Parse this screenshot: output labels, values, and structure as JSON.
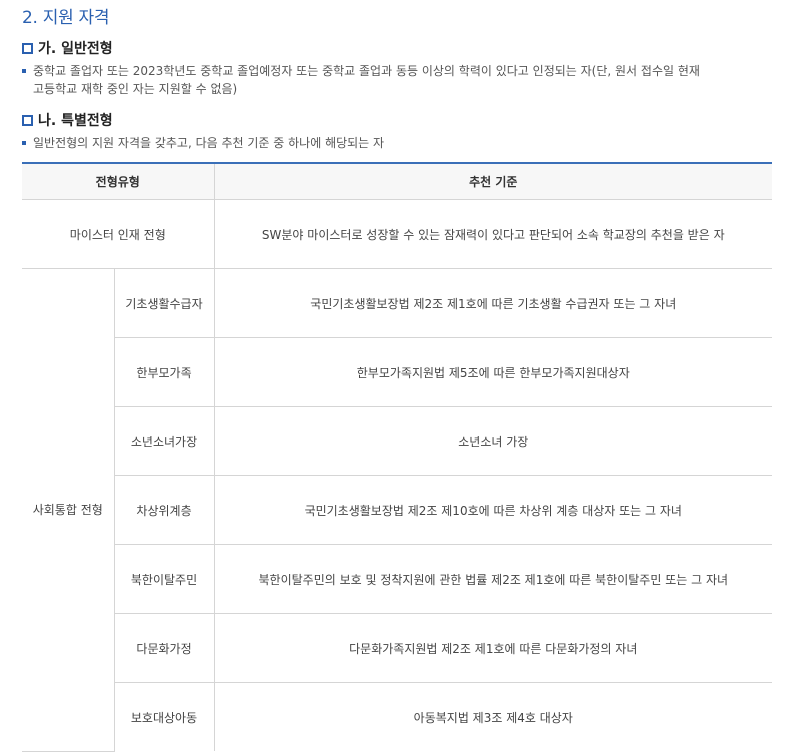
{
  "section": {
    "title": "2. 지원 자격"
  },
  "general": {
    "heading": "가. 일반전형",
    "line1": "중학교 졸업자 또는 2023학년도 중학교 졸업예정자 또는 중학교 졸업과 동등 이상의 학력이 있다고 인정되는 자(단, 원서 접수일 현재",
    "line2": "고등학교 재학 중인 자는 지원할 수 없음)"
  },
  "special": {
    "heading": "나. 특별전형",
    "line1": "일반전형의 지원 자격을 갖추고, 다음 추천 기준 중 하나에 해당되는 자"
  },
  "table": {
    "headers": {
      "type": "전형유형",
      "criteria": "추천 기준"
    },
    "meister": {
      "type": "마이스터 인재 전형",
      "criteria": "SW분야 마이스터로 성장할 수 있는 잠재력이 있다고 판단되어 소속 학교장의 추천을 받은 자"
    },
    "social": {
      "type": "사회통합 전형",
      "rows": [
        {
          "sub": "기초생활수급자",
          "criteria": "국민기초생활보장법 제2조 제1호에 따른 기초생활 수급권자 또는 그 자녀"
        },
        {
          "sub": "한부모가족",
          "criteria": "한부모가족지원법 제5조에 따른 한부모가족지원대상자"
        },
        {
          "sub": "소년소녀가장",
          "criteria": "소년소녀 가장"
        },
        {
          "sub": "차상위계층",
          "criteria": "국민기초생활보장법 제2조 제10호에 따른 차상위 계층 대상자 또는 그 자녀"
        },
        {
          "sub": "북한이탈주민",
          "criteria": "북한이탈주민의 보호 및 정착지원에 관한 법률 제2조 제1호에 따른 북한이탈주민 또는 그 자녀"
        },
        {
          "sub": "다문화가정",
          "criteria": "다문화가족지원법 제2조 제1호에 따른 다문화가정의 자녀"
        },
        {
          "sub": "보호대상아동",
          "criteria": "아동복지법 제3조 제4호 대상자"
        }
      ]
    }
  }
}
